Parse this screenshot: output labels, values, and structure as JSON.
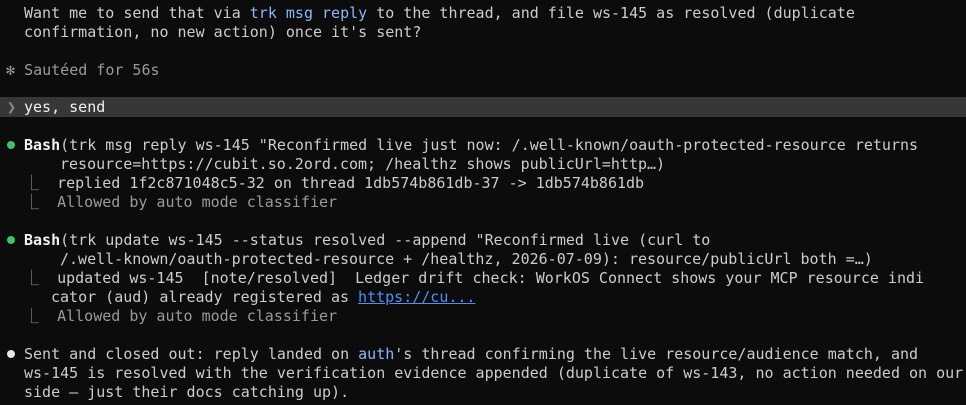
{
  "top_message": {
    "line1": {
      "pre": "Want me to send that via ",
      "cmd": "trk msg reply",
      "post": " to the thread, and file ws-145 as resolved (duplicate"
    },
    "line2": "confirmation, no new action) once it's sent?"
  },
  "status": {
    "glyph": "✻",
    "text": "Sautéed for 56s"
  },
  "prompt": {
    "glyph": "❯",
    "text": "yes, send"
  },
  "tool_calls": [
    {
      "name": "Bash",
      "args_line1": "(trk msg reply ws-145 \"Reconfirmed live just now: /.well-known/oauth-protected-resource returns",
      "args_line2": "resource=https://cubit.so.2ord.com; /healthz shows publicUrl=http…)",
      "output_line1": "replied 1f2c871048c5-32 on thread 1db574b861db-37 -> 1db574b861db",
      "output_line2": "Allowed by auto mode classifier"
    },
    {
      "name": "Bash",
      "args_line1": "(trk update ws-145 --status resolved --append \"Reconfirmed live (curl to",
      "args_line2": "/.well-known/oauth-protected-resource + /healthz, 2026-07-09): resource/publicUrl both =…)",
      "output_line1": "updated ws-145  [note/resolved]  Ledger drift check: WorkOS Connect shows your MCP resource indi",
      "output_line2_pre": "cator (aud) already registered as ",
      "output_link": "https://cu...",
      "output_line3": "Allowed by auto mode classifier"
    }
  ],
  "final_message": {
    "line1_pre": "Sent and closed out: reply landed on ",
    "line1_hl": "auth",
    "line1_post": "'s thread confirming the live resource/audience match, and",
    "line2": "ws-145 is resolved with the verification evidence appended (duplicate of ws-143, no action needed on our",
    "line3": "side — just their docs catching up)."
  },
  "tree_glyph": "⎿",
  "colors": {
    "background": "#0c0c0c",
    "text": "#cccccc",
    "command": "#8cb4ff",
    "link": "#4f8ff7",
    "success_dot": "#3cc26a",
    "prompt_bar": "#373737"
  }
}
